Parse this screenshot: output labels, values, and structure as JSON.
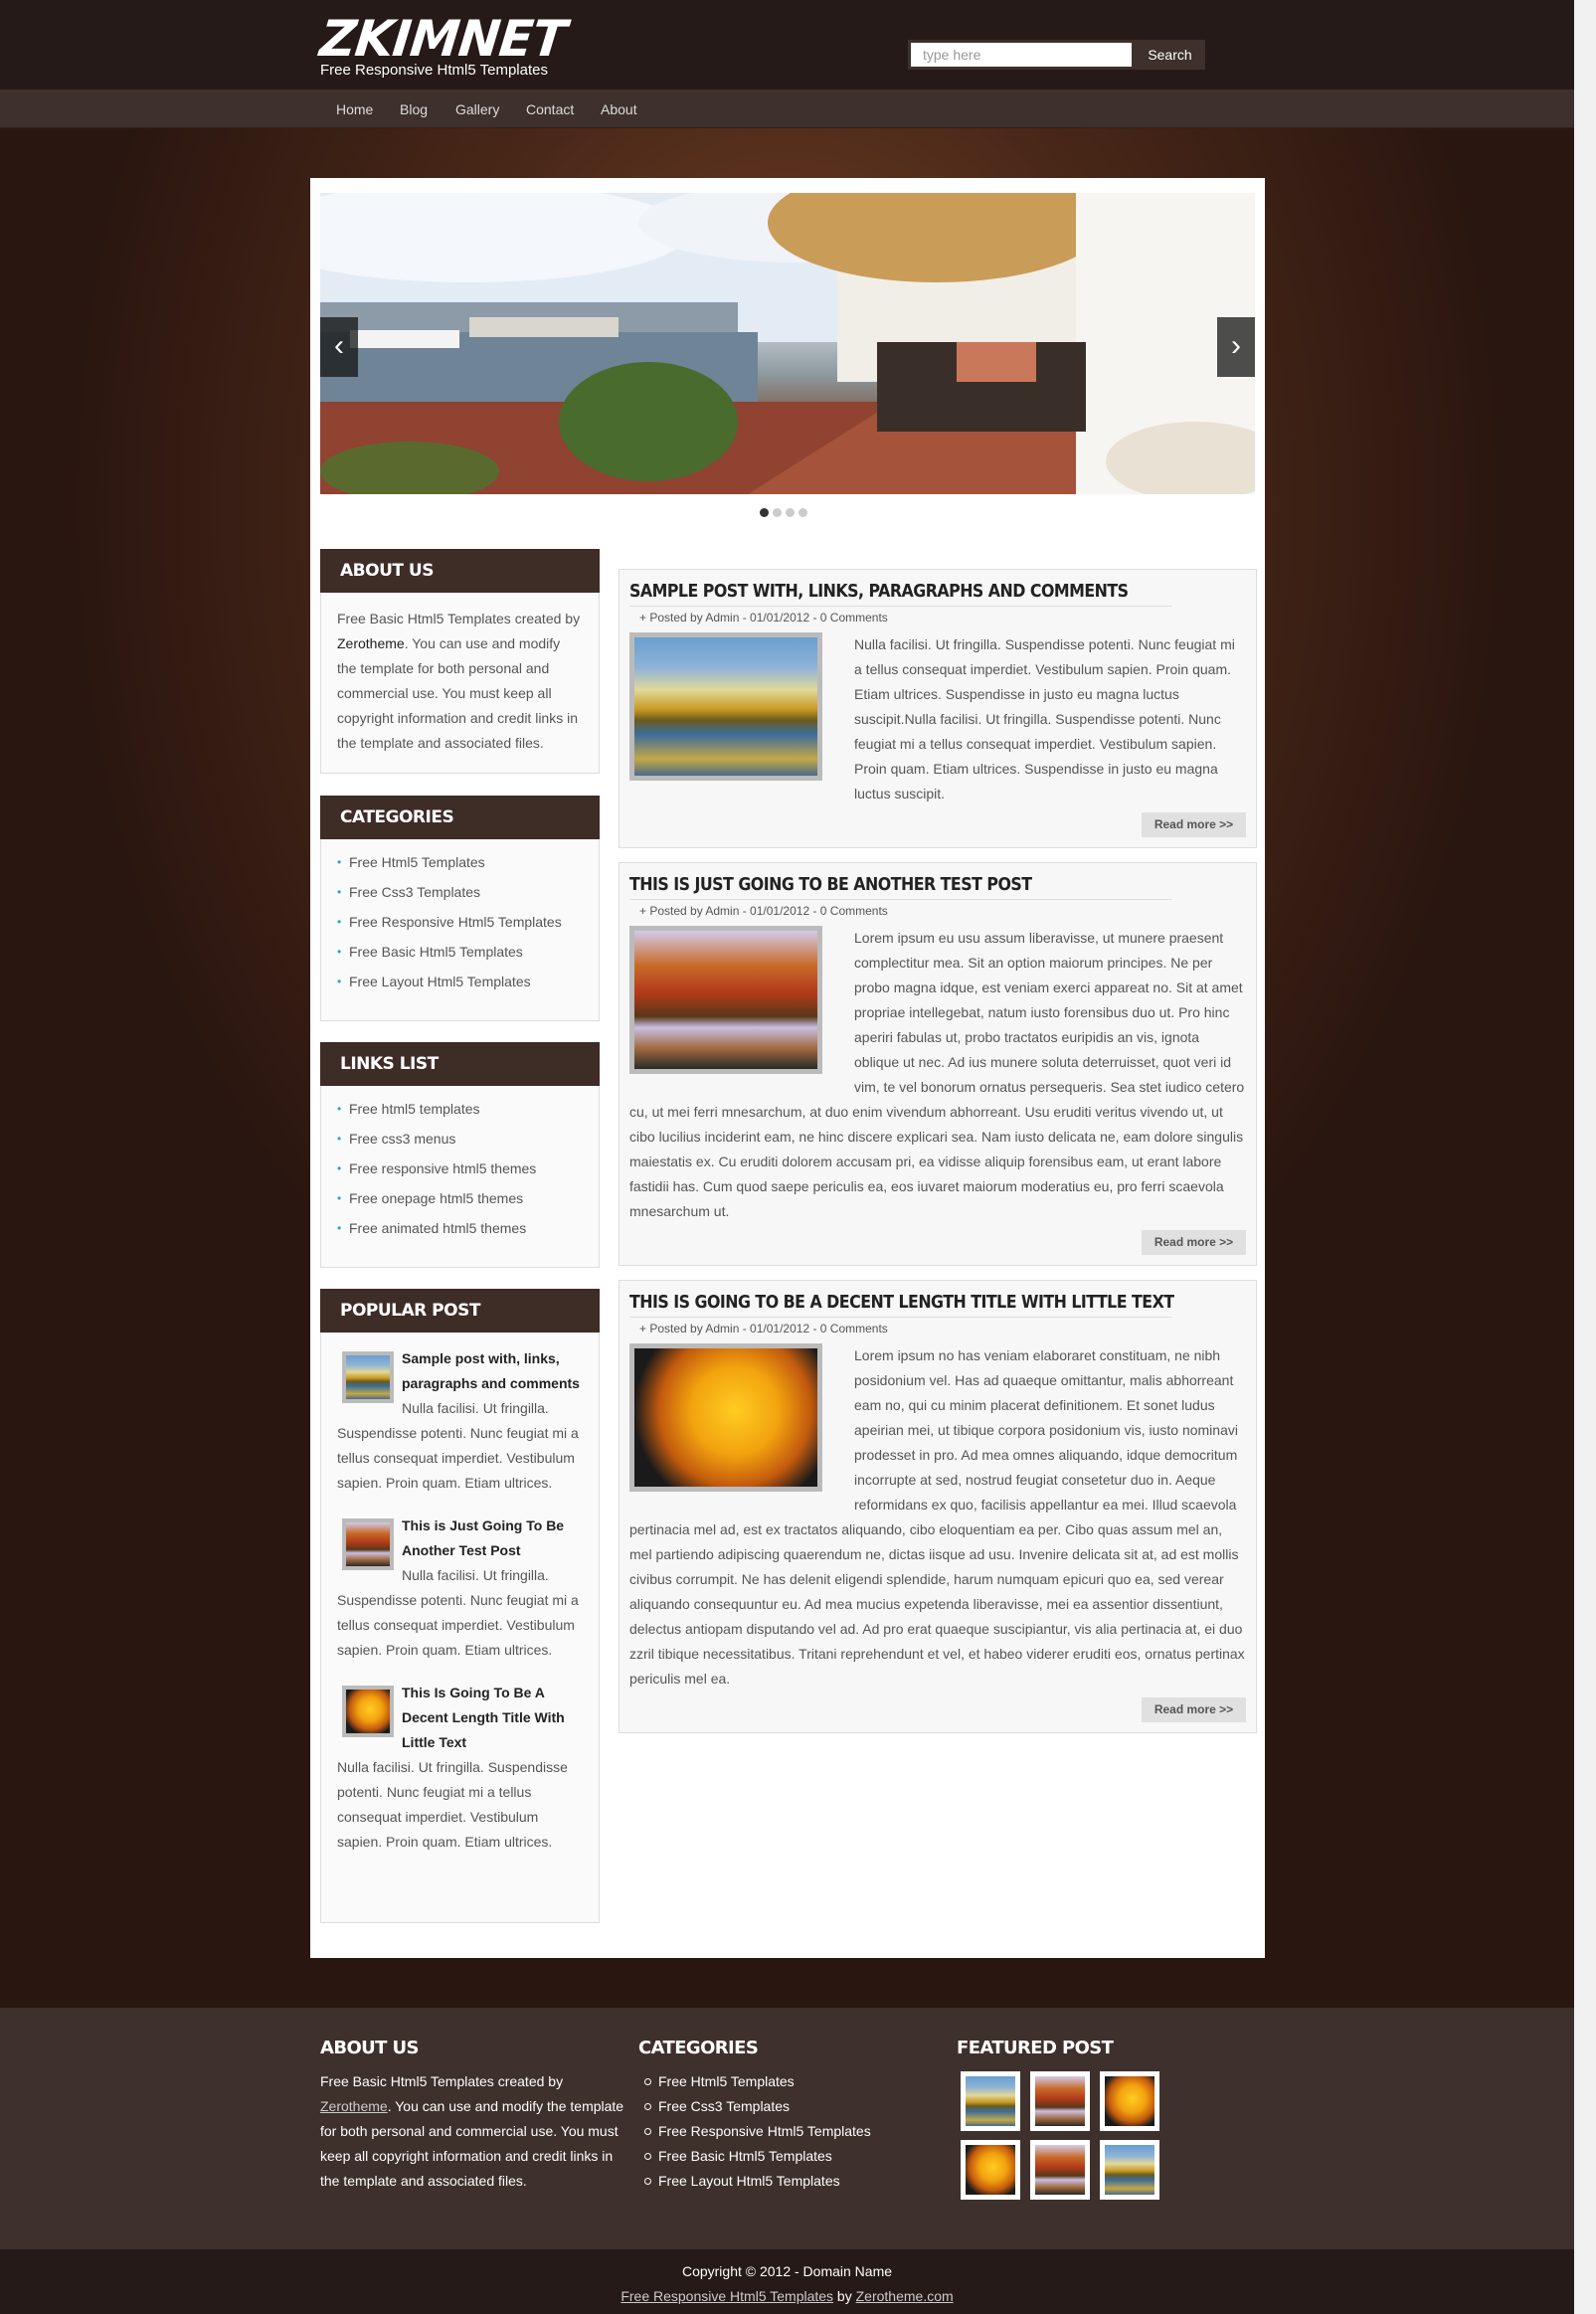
{
  "site": {
    "logo": "ZKIMNET",
    "tagline": "Free Responsive Html5 Templates"
  },
  "search": {
    "placeholder": "type here",
    "button_label": "Search"
  },
  "nav": [
    "Home",
    "Blog",
    "Gallery",
    "Contact",
    "About"
  ],
  "slider": {
    "prev_label": "‹",
    "next_label": "›",
    "dot_count": 4,
    "active_dot": 1
  },
  "sidebar": {
    "about": {
      "title": "ABOUT US",
      "text_before": "Free Basic Html5 Templates created by ",
      "link": "Zerotheme",
      "text_after": ". You can use and modify the template for both personal and commercial use. You must keep all copyright information and credit links in the template and associated files."
    },
    "categories": {
      "title": "CATEGORIES",
      "items": [
        "Free Html5 Templates",
        "Free Css3 Templates",
        "Free Responsive Html5 Templates",
        "Free Basic Html5 Templates",
        "Free Layout Html5 Templates"
      ]
    },
    "links": {
      "title": "LINKS LIST",
      "items": [
        "Free html5 templates",
        "Free css3 menus",
        "Free responsive html5 themes",
        "Free onepage html5 themes",
        "Free animated html5 themes"
      ]
    },
    "popular": {
      "title": "POPULAR POST",
      "items": [
        {
          "title": "Sample post with, links, paragraphs and comments",
          "text": "Nulla facilisi. Ut fringilla. Suspendisse potenti. Nunc feugiat mi a tellus consequat imperdiet. Vestibulum sapien. Proin quam. Etiam ultrices."
        },
        {
          "title": "This is Just Going To Be Another Test Post",
          "text": "Nulla facilisi. Ut fringilla. Suspendisse potenti. Nunc feugiat mi a tellus consequat imperdiet. Vestibulum sapien. Proin quam. Etiam ultrices."
        },
        {
          "title": "This Is Going To Be A Decent Length Title With Little Text",
          "text": "Nulla facilisi. Ut fringilla. Suspendisse potenti. Nunc feugiat mi a tellus consequat imperdiet. Vestibulum sapien. Proin quam. Etiam ultrices."
        }
      ]
    }
  },
  "posts": [
    {
      "title": "SAMPLE POST WITH, LINKS, PARAGRAPHS AND COMMENTS",
      "meta": "+ Posted by Admin - 01/01/2012 - 0 Comments",
      "body": "Nulla facilisi. Ut fringilla. Suspendisse potenti. Nunc feugiat mi a tellus consequat imperdiet. Vestibulum sapien. Proin quam. Etiam ultrices. Suspendisse in justo eu magna luctus suscipit.Nulla facilisi. Ut fringilla. Suspendisse potenti. Nunc feugiat mi a tellus consequat imperdiet. Vestibulum sapien. Proin quam. Etiam ultrices. Suspendisse in justo eu magna luctus suscipit.",
      "read_more": "Read more >>"
    },
    {
      "title": "THIS IS JUST GOING TO BE ANOTHER TEST POST",
      "meta": "+ Posted by Admin - 01/01/2012 - 0 Comments",
      "body": "Lorem ipsum eu usu assum liberavisse, ut munere praesent complectitur mea. Sit an option maiorum principes. Ne per probo magna idque, est veniam exerci appareat no. Sit at amet propriae intellegebat, natum iusto forensibus duo ut. Pro hinc aperiri fabulas ut, probo tractatos euripidis an vis, ignota oblique ut nec. Ad ius munere soluta deterruisset, quot veri id vim, te vel bonorum ornatus persequeris. Sea stet iudico cetero cu, ut mei ferri mnesarchum, at duo enim vivendum abhorreant. Usu eruditi veritus vivendo ut, ut cibo lucilius inciderint eam, ne hinc discere explicari sea. Nam iusto delicata ne, eam dolore singulis maiestatis ex. Cu eruditi dolorem accusam pri, ea vidisse aliquip forensibus eam, ut erant labore fastidii has. Cum quod saepe periculis ea, eos iuvaret maiorum moderatius eu, pro ferri scaevola mnesarchum ut.",
      "read_more": "Read more >>"
    },
    {
      "title": "THIS IS GOING TO BE A DECENT LENGTH TITLE WITH LITTLE TEXT",
      "meta": "+ Posted by Admin - 01/01/2012 - 0 Comments",
      "body": "Lorem ipsum no has veniam elaboraret constituam, ne nibh posidonium vel. Has ad quaeque omittantur, malis abhorreant eam no, qui cu minim placerat definitionem. Et sonet ludus apeirian mei, ut tibique corpora posidonium vis, iusto nominavi prodesset in pro. Ad mea omnes aliquando, idque democritum incorrupte at sed, nostrud feugiat consetetur duo in. Aeque reformidans ex quo, facilisis appellantur ea mei. Illud scaevola pertinacia mel ad, est ex tractatos aliquando, cibo eloquentiam ea per. Cibo quas assum mel an, mel partiendo adipiscing quaerendum ne, dictas iisque ad usu. Invenire delicata sit at, ad est mollis civibus corrumpit. Ne has delenit eligendi splendide, harum numquam epicuri quo ea, sed verear aliquando consequuntur eu. Ad mea mucius expetenda liberavisse, mei ea assentior dissentiunt, delectus antiopam disputando vel ad. Ad pro erat quaeque suscipiantur, vis alia pertinacia at, ei duo zzril tibique necessitatibus. Tritani reprehendunt et vel, et habeo viderer eruditi eos, ornatus pertinax periculis mel ea.",
      "read_more": "Read more >>"
    }
  ],
  "footer": {
    "about": {
      "title": "ABOUT US",
      "text_before": "Free Basic Html5 Templates created by ",
      "link": "Zerotheme",
      "text_after": ". You can use and modify the template for both personal and commercial use. You must keep all copyright information and credit links in the template and associated files."
    },
    "categories": {
      "title": "CATEGORIES",
      "items": [
        "Free Html5 Templates",
        "Free Css3 Templates",
        "Free Responsive Html5 Templates",
        "Free Basic Html5 Templates",
        "Free Layout Html5 Templates"
      ]
    },
    "featured": {
      "title": "FEATURED POST"
    },
    "copyright": "Copyright © 2012 - Domain Name",
    "credit_link1": "Free Responsive Html5 Templates",
    "credit_by": " by ",
    "credit_link2": "Zerotheme.com"
  }
}
